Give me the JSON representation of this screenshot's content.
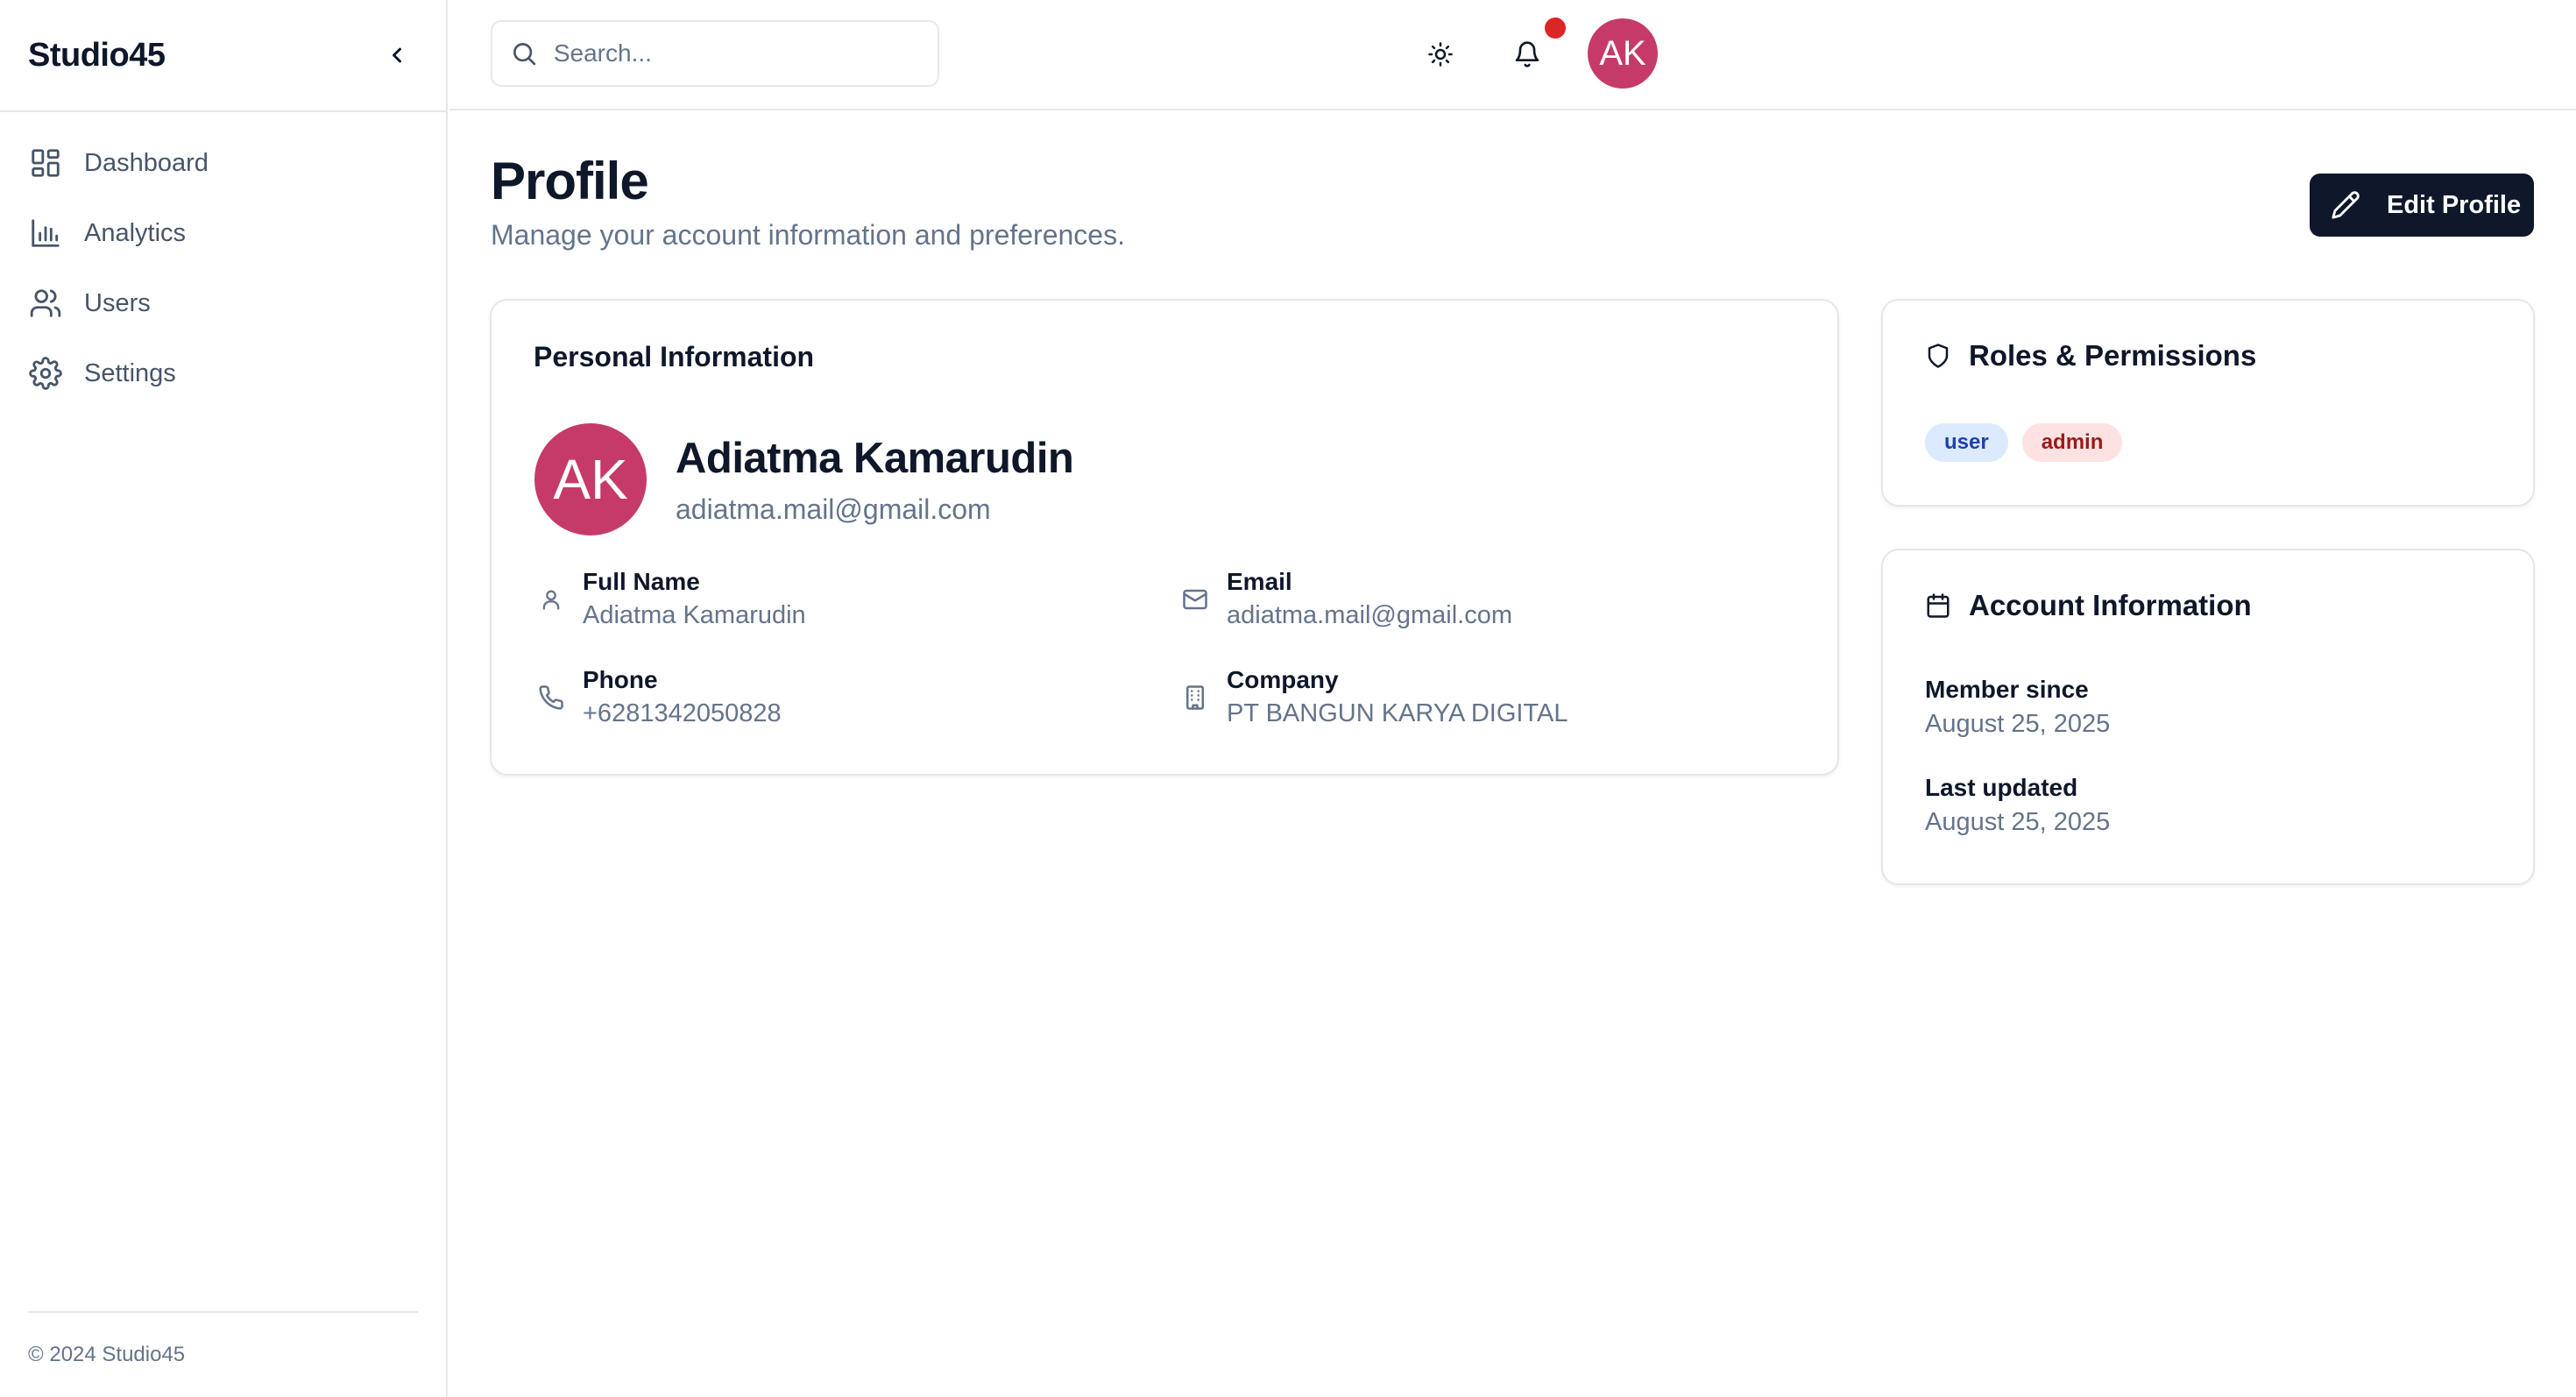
{
  "app": {
    "brand": "Studio45"
  },
  "sidebar": {
    "items": [
      {
        "label": "Dashboard",
        "icon": "dashboard-icon"
      },
      {
        "label": "Analytics",
        "icon": "bar-chart-icon"
      },
      {
        "label": "Users",
        "icon": "users-icon"
      },
      {
        "label": "Settings",
        "icon": "gear-icon"
      }
    ],
    "footer": "© 2024 Studio45"
  },
  "topbar": {
    "search_placeholder": "Search...",
    "avatar_initials": "AK",
    "has_notification": true
  },
  "page": {
    "title": "Profile",
    "subtitle": "Manage your account information and preferences.",
    "edit_button": "Edit Profile"
  },
  "personal": {
    "title": "Personal Information",
    "initials": "AK",
    "name": "Adiatma Kamarudin",
    "email": "adiatma.mail@gmail.com",
    "fields": {
      "full_name": {
        "label": "Full Name",
        "value": "Adiatma Kamarudin"
      },
      "email": {
        "label": "Email",
        "value": "adiatma.mail@gmail.com"
      },
      "phone": {
        "label": "Phone",
        "value": "+6281342050828"
      },
      "company": {
        "label": "Company",
        "value": "PT BANGUN KARYA DIGITAL"
      }
    }
  },
  "roles": {
    "title": "Roles & Permissions",
    "badges": [
      "user",
      "admin"
    ]
  },
  "account": {
    "title": "Account Information",
    "member_since": {
      "label": "Member since",
      "value": "August 25, 2025"
    },
    "last_updated": {
      "label": "Last updated",
      "value": "August 25, 2025"
    }
  },
  "colors": {
    "avatar": "#c63a6a",
    "primary_button": "#0f172a",
    "notification_dot": "#dc2626",
    "badge_user_bg": "#dbeafe",
    "badge_admin_bg": "#fee2e2"
  }
}
